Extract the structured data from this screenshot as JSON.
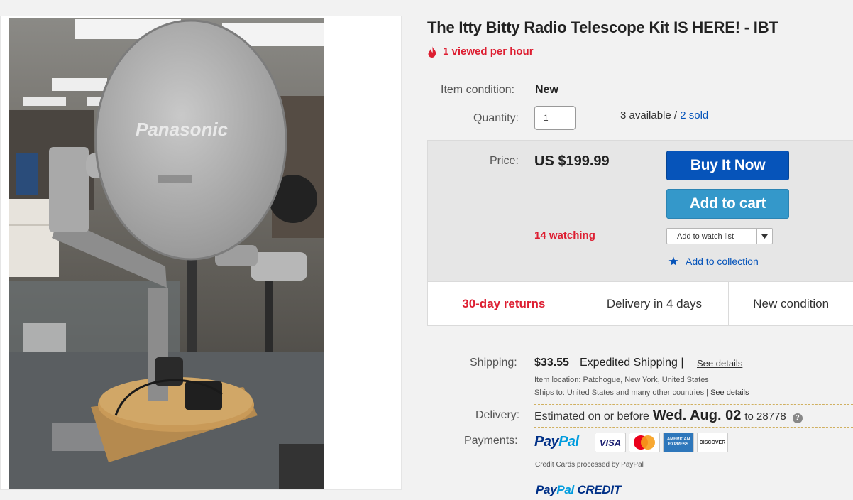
{
  "product": {
    "title": "The Itty Bitty Radio Telescope Kit IS HERE! - IBT",
    "views": "1 viewed per hour",
    "image_alt": "Panasonic"
  },
  "details": {
    "condition_label": "Item condition:",
    "condition_value": "New",
    "quantity_label": "Quantity:",
    "quantity_value": "1",
    "available": "3 available",
    "separator": " / ",
    "sold": "2 sold"
  },
  "price": {
    "label": "Price:",
    "value": "US $199.99",
    "watching": "14 watching"
  },
  "actions": {
    "buy_now": "Buy It Now",
    "add_to_cart": "Add to cart",
    "add_to_watch": "Add to watch list",
    "add_to_collection": "Add to collection"
  },
  "features": {
    "returns": "30-day returns",
    "delivery": "Delivery in 4 days",
    "condition": "New condition"
  },
  "shipping": {
    "label": "Shipping:",
    "price": "$33.55",
    "method": "Expedited Shipping |",
    "see_details": "See details",
    "location": "Item location:  Patchogue, New York, United States",
    "ships_to": "Ships to:  United States and many other countries | ",
    "ships_to_link": "See details"
  },
  "delivery": {
    "label": "Delivery:",
    "estimated": "Estimated on or before",
    "date": "Wed. Aug. 02",
    "to": "to 28778"
  },
  "payments": {
    "label": "Payments:",
    "paypal_a": "Pay",
    "paypal_b": "Pal",
    "visa": "VISA",
    "amex": "AMERICAN EXPRESS",
    "discover": "DISCOVER",
    "note": "Credit Cards processed by PayPal",
    "credit": "CREDIT"
  },
  "colors": {
    "accent_red": "#dd1e31",
    "link_blue": "#0654ba",
    "buy_blue": "#0654ba",
    "cart_blue": "#3498ca"
  }
}
